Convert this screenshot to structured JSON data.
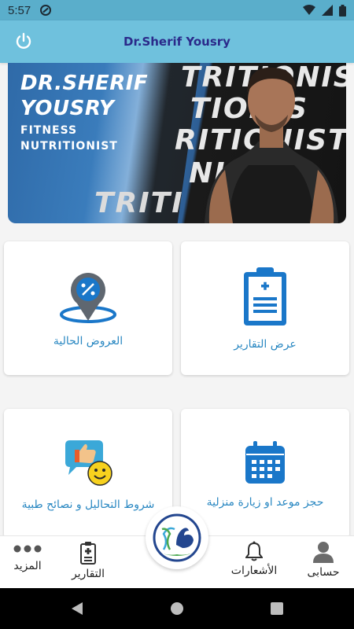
{
  "status_bar": {
    "time": "5:57"
  },
  "app_bar": {
    "title": "Dr.Sherif Yousry"
  },
  "banner": {
    "name_line1": "DR.SHERIF",
    "name_line2": "YOUSRY",
    "sub_line1": "FITNESS",
    "sub_line2": "NUTRITIONIST",
    "bg_words": [
      "TRITIONIST",
      "TIONIS",
      "RITIONIST",
      "NIS",
      "TRITI"
    ]
  },
  "cards": {
    "reports": {
      "label": "عرض التقارير",
      "icon": "clipboard-icon"
    },
    "offers": {
      "label": "العروض الحالية",
      "icon": "discount-pin-icon"
    },
    "booking": {
      "label": "حجز موعد او زيارة منزلية",
      "icon": "calendar-icon"
    },
    "tips": {
      "label": "شروط التحاليل و نصائح طبية",
      "icon": "thumbs-up-chat-icon"
    }
  },
  "bottom_nav": {
    "account": "حسابى",
    "notifications": "الأشعارات",
    "reports": "التقارير",
    "more": "المزيد"
  },
  "colors": {
    "app_bar": "#6fc1dd",
    "title": "#2b2a8a",
    "accent": "#2a88c2",
    "icon_blue": "#1a77c9"
  }
}
